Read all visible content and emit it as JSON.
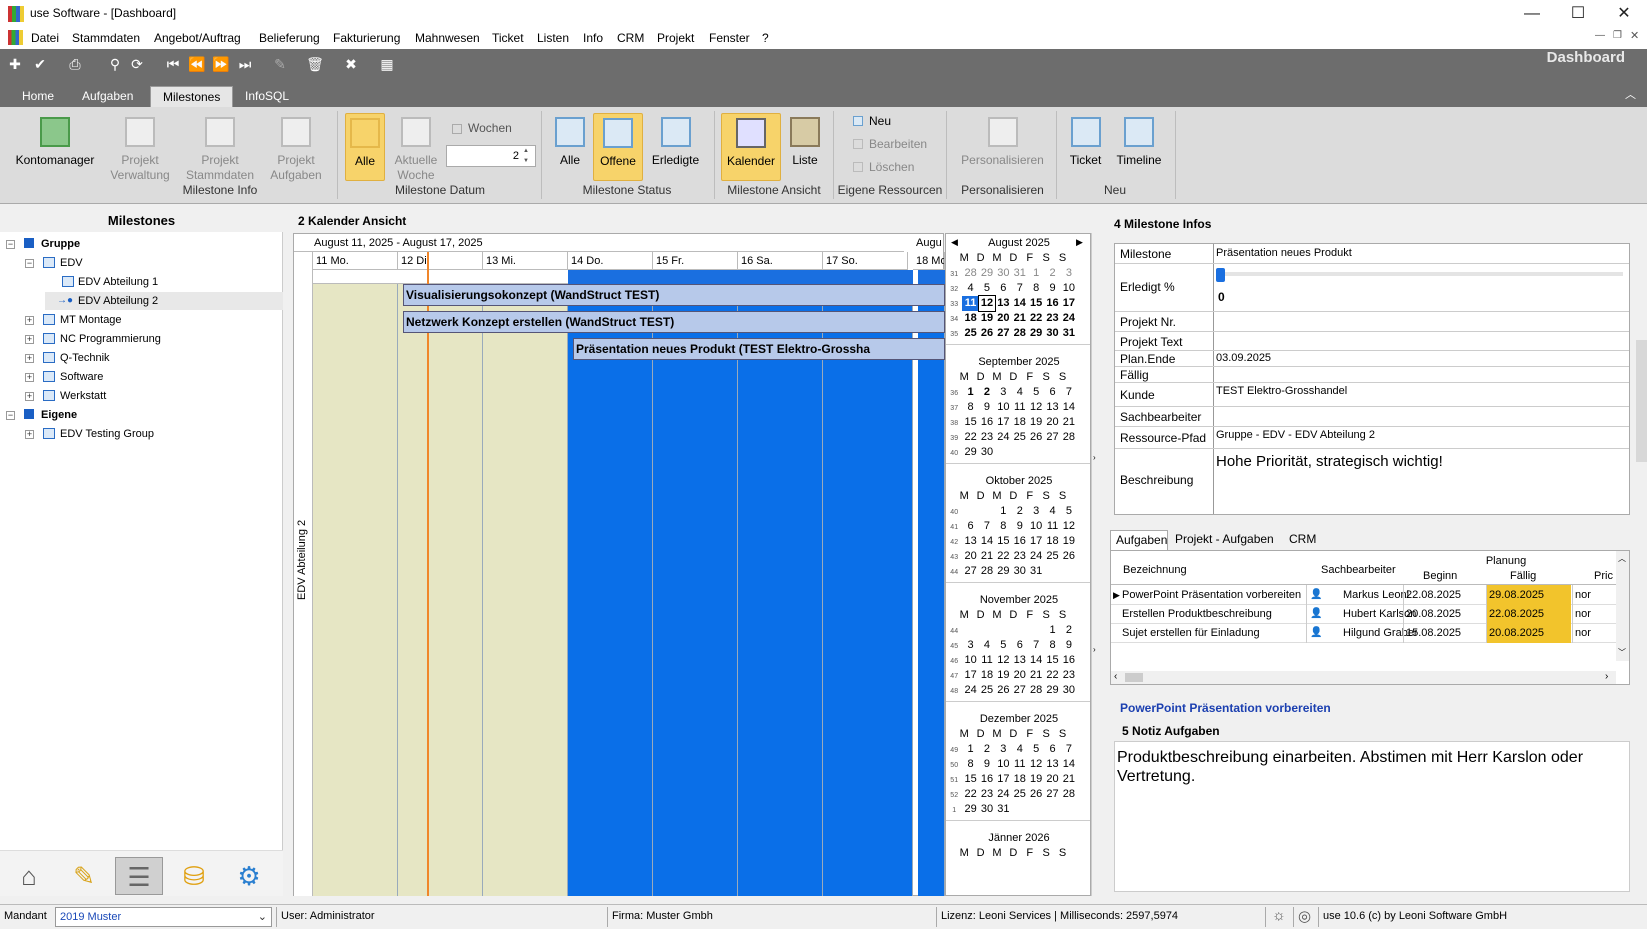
{
  "window": {
    "title": "use Software - [Dashboard]",
    "minimize": "—",
    "maximize": "☐",
    "close": "✕"
  },
  "menu": [
    "Datei",
    "Stammdaten",
    "Angebot/Auftrag",
    "Belieferung",
    "Fakturierung",
    "Mahnwesen",
    "Ticket",
    "Listen",
    "Info",
    "CRM",
    "Projekt",
    "Fenster",
    "?"
  ],
  "header": {
    "dashboard_title": "Dashboard"
  },
  "tabs": [
    "Home",
    "Aufgaben",
    "Milestones",
    "InfoSQL"
  ],
  "ribbon": {
    "kontomanager": "Kontomanager",
    "projekt_verwaltung_1": "Projekt",
    "projekt_verwaltung_2": "Verwaltung",
    "projekt_stammdaten_1": "Projekt",
    "projekt_stammdaten_2": "Stammdaten",
    "projekt_aufgaben_1": "Projekt",
    "projekt_aufgaben_2": "Aufgaben",
    "group_info": "Milestone Info",
    "alle_datum": "Alle",
    "aktuelle_1": "Aktuelle",
    "aktuelle_2": "Woche",
    "wochen_label": "Wochen",
    "wochen_value": "2",
    "group_datum": "Milestone Datum",
    "status_alle": "Alle",
    "status_offene": "Offene",
    "status_erledigte": "Erledigte",
    "group_status": "Milestone Status",
    "ansicht_kalender": "Kalender",
    "ansicht_liste": "Liste",
    "group_ansicht": "Milestone Ansicht",
    "neu": "Neu",
    "bearbeiten": "Bearbeiten",
    "loeschen": "Löschen",
    "group_ressourcen": "Eigene Ressourcen",
    "personalisieren": "Personalisieren",
    "group_personalisieren": "Personalisieren",
    "ticket": "Ticket",
    "timeline": "Timeline",
    "group_neu": "Neu"
  },
  "left": {
    "title": "Milestones",
    "tree": [
      {
        "label": "Gruppe",
        "bold": true
      },
      {
        "label": "EDV"
      },
      {
        "label": "EDV Abteilung 1"
      },
      {
        "label": "EDV Abteilung 2"
      },
      {
        "label": "MT Montage"
      },
      {
        "label": "NC Programmierung"
      },
      {
        "label": "Q-Technik"
      },
      {
        "label": "Software"
      },
      {
        "label": "Werkstatt"
      },
      {
        "label": "Eigene",
        "bold": true
      },
      {
        "label": "EDV Testing Group"
      }
    ]
  },
  "calendar": {
    "panel_num": "2",
    "panel_label": "Kalender Ansicht",
    "range": "August 11, 2025 - August 17, 2025",
    "next_range": "Augu",
    "days": [
      "11 Mo.",
      "12 Di.",
      "13 Mi.",
      "14 Do.",
      "15 Fr.",
      "16 Sa.",
      "17 So.",
      "18 Mo"
    ],
    "resource": "EDV Abteilung 2",
    "events": [
      "Visualisierungsokonzept (WandStruct TEST)",
      "Netzwerk Konzept erstellen (WandStruct TEST)",
      "Präsentation neues Produkt (TEST Elektro-Grossha"
    ]
  },
  "minical": {
    "weekdays": [
      "M",
      "D",
      "M",
      "D",
      "F",
      "S",
      "S"
    ],
    "months": [
      {
        "name": "August 2025",
        "weeks": [
          [
            "31",
            "28",
            "29",
            "30",
            "31",
            "1",
            "2",
            "3"
          ],
          [
            "32",
            "4",
            "5",
            "6",
            "7",
            "8",
            "9",
            "10"
          ],
          [
            "33",
            "11",
            "12",
            "13",
            "14",
            "15",
            "16",
            "17"
          ],
          [
            "34",
            "18",
            "19",
            "20",
            "21",
            "22",
            "23",
            "24"
          ],
          [
            "35",
            "25",
            "26",
            "27",
            "28",
            "29",
            "30",
            "31"
          ]
        ]
      },
      {
        "name": "September 2025",
        "weeks": [
          [
            "36",
            "1",
            "2",
            "3",
            "4",
            "5",
            "6",
            "7"
          ],
          [
            "37",
            "8",
            "9",
            "10",
            "11",
            "12",
            "13",
            "14"
          ],
          [
            "38",
            "15",
            "16",
            "17",
            "18",
            "19",
            "20",
            "21"
          ],
          [
            "39",
            "22",
            "23",
            "24",
            "25",
            "26",
            "27",
            "28"
          ],
          [
            "40",
            "29",
            "30",
            "",
            "",
            "",
            "",
            ""
          ]
        ]
      },
      {
        "name": "Oktober 2025",
        "weeks": [
          [
            "40",
            "",
            "",
            "1",
            "2",
            "3",
            "4",
            "5"
          ],
          [
            "41",
            "6",
            "7",
            "8",
            "9",
            "10",
            "11",
            "12"
          ],
          [
            "42",
            "13",
            "14",
            "15",
            "16",
            "17",
            "18",
            "19"
          ],
          [
            "43",
            "20",
            "21",
            "22",
            "23",
            "24",
            "25",
            "26"
          ],
          [
            "44",
            "27",
            "28",
            "29",
            "30",
            "31",
            "",
            ""
          ]
        ]
      },
      {
        "name": "November 2025",
        "weeks": [
          [
            "44",
            "",
            "",
            "",
            "",
            "",
            "1",
            "2"
          ],
          [
            "45",
            "3",
            "4",
            "5",
            "6",
            "7",
            "8",
            "9"
          ],
          [
            "46",
            "10",
            "11",
            "12",
            "13",
            "14",
            "15",
            "16"
          ],
          [
            "47",
            "17",
            "18",
            "19",
            "20",
            "21",
            "22",
            "23"
          ],
          [
            "48",
            "24",
            "25",
            "26",
            "27",
            "28",
            "29",
            "30"
          ]
        ]
      },
      {
        "name": "Dezember 2025",
        "weeks": [
          [
            "49",
            "1",
            "2",
            "3",
            "4",
            "5",
            "6",
            "7"
          ],
          [
            "50",
            "8",
            "9",
            "10",
            "11",
            "12",
            "13",
            "14"
          ],
          [
            "51",
            "15",
            "16",
            "17",
            "18",
            "19",
            "20",
            "21"
          ],
          [
            "52",
            "22",
            "23",
            "24",
            "25",
            "26",
            "27",
            "28"
          ],
          [
            "1",
            "29",
            "30",
            "31",
            "",
            "",
            "",
            ""
          ]
        ]
      },
      {
        "name": "Jänner 2026",
        "weeks": []
      }
    ]
  },
  "info": {
    "panel_num": "4",
    "panel_label": "Milestone Infos",
    "milestone_label": "Milestone",
    "milestone": "Präsentation neues Produkt",
    "erledigt_label": "Erledigt %",
    "erledigt": "0",
    "projektnr_label": "Projekt Nr.",
    "projektnr": "",
    "projekttext_label": "Projekt Text",
    "projekttext": "",
    "planende_label": "Plan.Ende",
    "planende": "03.09.2025",
    "faellig_label": "Fällig",
    "faellig": "",
    "kunde_label": "Kunde",
    "kunde": "TEST Elektro-Grosshandel",
    "sachbearbeiter_label": "Sachbearbeiter",
    "sachbearbeiter": "",
    "ressource_label": "Ressource-Pfad",
    "ressource": "Gruppe - EDV - EDV Abteilung 2",
    "beschreibung_label": "Beschreibung",
    "beschreibung": "Hohe Priorität, strategisch wichtig!"
  },
  "tasks": {
    "tabs": [
      "Aufgaben",
      "Projekt - Aufgaben",
      "CRM"
    ],
    "planung": "Planung",
    "col_bezeichnung": "Bezeichnung",
    "col_sachbearbeiter": "Sachbearbeiter",
    "col_beginn": "Beginn",
    "col_faellig": "Fällig",
    "col_prio": "Pric",
    "rows": [
      {
        "bez": "PowerPoint Präsentation vorbereiten",
        "sb": "Markus Leoni",
        "beginn": "22.08.2025",
        "faellig": "29.08.2025",
        "prio": "nor"
      },
      {
        "bez": "Erstellen Produktbeschreibung",
        "sb": "Hubert Karlson",
        "beginn": "20.08.2025",
        "faellig": "22.08.2025",
        "prio": "nor"
      },
      {
        "bez": "Sujet erstellen für Einladung",
        "sb": "Hilgund Graber",
        "beginn": "15.08.2025",
        "faellig": "20.08.2025",
        "prio": "nor"
      }
    ],
    "selected_title": "PowerPoint Präsentation vorbereiten",
    "notiz_num": "5",
    "notiz_label": "Notiz Aufgaben",
    "notiz": "Produktbeschreibung einarbeiten. Abstimen mit Herr Karslon oder Vertretung."
  },
  "status": {
    "mandant_label": "Mandant",
    "mandant": "2019 Muster",
    "user": "User: Administrator",
    "firma": "Firma: Muster Gmbh",
    "lizenz": "Lizenz: Leoni Services | Milliseconds: 2597,5974",
    "version": "use 10.6 (c) by Leoni Software GmbH"
  }
}
